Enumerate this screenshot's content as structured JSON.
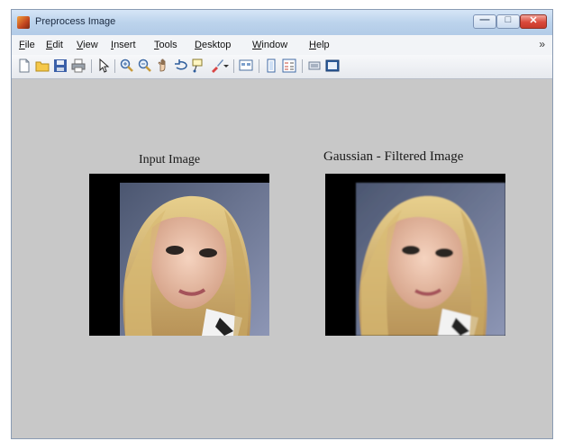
{
  "window": {
    "title": "Preprocess Image",
    "controls": {
      "minimize": "—",
      "maximize": "□",
      "close": "✕"
    }
  },
  "menubar": {
    "items": [
      {
        "label": "File",
        "accel": "F",
        "rest": "ile"
      },
      {
        "label": "Edit",
        "accel": "E",
        "rest": "dit"
      },
      {
        "label": "View",
        "accel": "V",
        "rest": "iew"
      },
      {
        "label": "Insert",
        "accel": "I",
        "rest": "nsert"
      },
      {
        "label": "Tools",
        "accel": "T",
        "rest": "ools"
      },
      {
        "label": "Desktop",
        "accel": "D",
        "rest": "esktop"
      },
      {
        "label": "Window",
        "accel": "W",
        "rest": "indow"
      },
      {
        "label": "Help",
        "accel": "H",
        "rest": "elp"
      }
    ],
    "overflow": "»"
  },
  "toolbar": {
    "icons": [
      "new-figure-icon",
      "open-file-icon",
      "save-figure-icon",
      "print-figure-icon",
      "select-arrow-icon",
      "zoom-in-icon",
      "zoom-out-icon",
      "pan-icon",
      "rotate-3d-icon",
      "data-cursor-icon",
      "brush-icon",
      "brush-dropdown-icon",
      "link-plot-icon",
      "insert-colorbar-icon",
      "insert-legend-icon",
      "hide-plot-tools-icon",
      "show-plot-tools-icon"
    ]
  },
  "axes": {
    "left_title": "Input Image",
    "right_title": "Gaussian - Filtered Image"
  },
  "colors": {
    "figure_background": "#c8c8c8",
    "title_bar": "#bcd3ec",
    "close_button": "#d9483a"
  }
}
